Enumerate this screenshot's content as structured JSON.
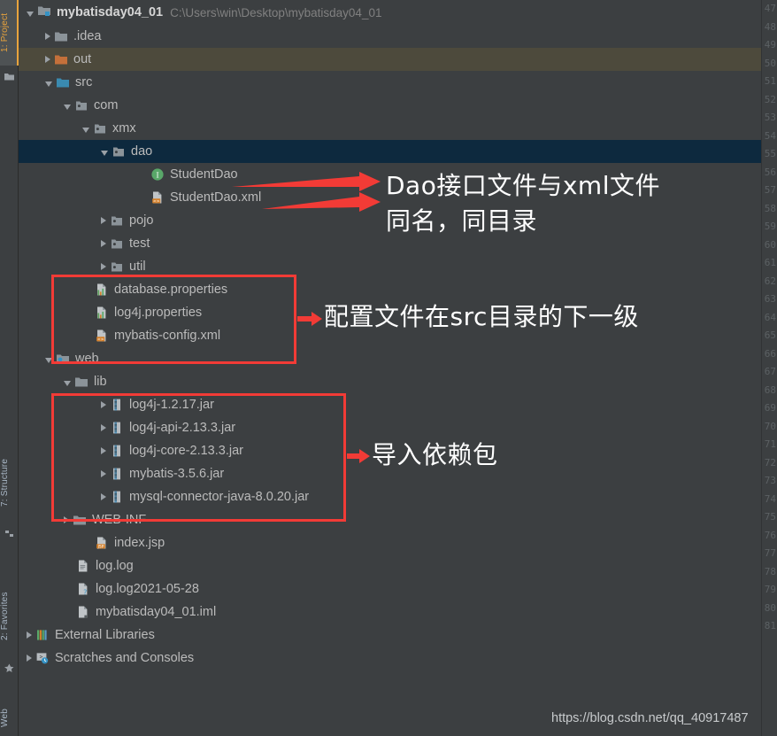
{
  "window": {
    "background_color": "#3c3f41",
    "accent_color": "#f23b36",
    "selected_row_color": "#0d293e",
    "modified_row_color": "#4d4a3c"
  },
  "left_tool_strip": {
    "tabs": [
      {
        "label": "1: Project",
        "active": true
      },
      {
        "label": "7: Structure",
        "active": false
      },
      {
        "label": "2: Favorites",
        "active": false
      },
      {
        "label": "Web",
        "active": false
      }
    ]
  },
  "project_tree": {
    "root": {
      "name": "mybatisday04_01",
      "path": "C:\\Users\\win\\Desktop\\mybatisday04_01",
      "icon": "project-module-icon",
      "state": "open"
    },
    "rows": [
      {
        "label": ".idea",
        "indent": 1,
        "state": "closed",
        "icon": "folder-icon",
        "highlight": "none"
      },
      {
        "label": "out",
        "indent": 1,
        "state": "closed",
        "icon": "folder-excluded-icon",
        "highlight": "olive"
      },
      {
        "label": "src",
        "indent": 1,
        "state": "open",
        "icon": "folder-source-icon",
        "highlight": "none"
      },
      {
        "label": "com",
        "indent": 2,
        "state": "open",
        "icon": "package-icon",
        "highlight": "none"
      },
      {
        "label": "xmx",
        "indent": 3,
        "state": "open",
        "icon": "package-icon",
        "highlight": "none"
      },
      {
        "label": "dao",
        "indent": 4,
        "state": "open",
        "icon": "package-icon",
        "highlight": "blue"
      },
      {
        "label": "StudentDao",
        "indent": 6,
        "state": "leaf",
        "icon": "java-interface-icon",
        "highlight": "none"
      },
      {
        "label": "StudentDao.xml",
        "indent": 6,
        "state": "leaf",
        "icon": "xml-file-icon",
        "highlight": "none"
      },
      {
        "label": "pojo",
        "indent": 4,
        "state": "closed",
        "icon": "package-icon",
        "highlight": "none"
      },
      {
        "label": "test",
        "indent": 4,
        "state": "closed",
        "icon": "package-icon",
        "highlight": "none"
      },
      {
        "label": "util",
        "indent": 4,
        "state": "closed",
        "icon": "package-icon",
        "highlight": "none"
      },
      {
        "label": "database.properties",
        "indent": 3,
        "state": "leaf",
        "icon": "properties-file-icon",
        "highlight": "none"
      },
      {
        "label": "log4j.properties",
        "indent": 3,
        "state": "leaf",
        "icon": "properties-file-icon",
        "highlight": "none"
      },
      {
        "label": "mybatis-config.xml",
        "indent": 3,
        "state": "leaf",
        "icon": "xml-file-icon",
        "highlight": "none"
      },
      {
        "label": "web",
        "indent": 1,
        "state": "open",
        "icon": "folder-web-icon",
        "highlight": "none"
      },
      {
        "label": "lib",
        "indent": 2,
        "state": "open",
        "icon": "folder-icon",
        "highlight": "none"
      },
      {
        "label": "log4j-1.2.17.jar",
        "indent": 4,
        "state": "closed",
        "icon": "jar-file-icon",
        "highlight": "none"
      },
      {
        "label": "log4j-api-2.13.3.jar",
        "indent": 4,
        "state": "closed",
        "icon": "jar-file-icon",
        "highlight": "none"
      },
      {
        "label": "log4j-core-2.13.3.jar",
        "indent": 4,
        "state": "closed",
        "icon": "jar-file-icon",
        "highlight": "none"
      },
      {
        "label": "mybatis-3.5.6.jar",
        "indent": 4,
        "state": "closed",
        "icon": "jar-file-icon",
        "highlight": "none"
      },
      {
        "label": "mysql-connector-java-8.0.20.jar",
        "indent": 4,
        "state": "closed",
        "icon": "jar-file-icon",
        "highlight": "none"
      },
      {
        "label": "WEB-INF",
        "indent": 2,
        "state": "closed",
        "icon": "folder-icon",
        "highlight": "none"
      },
      {
        "label": "index.jsp",
        "indent": 3,
        "state": "leaf",
        "icon": "jsp-file-icon",
        "highlight": "none"
      },
      {
        "label": "log.log",
        "indent": 2,
        "state": "leaf",
        "icon": "text-file-icon",
        "highlight": "none"
      },
      {
        "label": "log.log2021-05-28",
        "indent": 2,
        "state": "leaf",
        "icon": "unknown-file-icon",
        "highlight": "none"
      },
      {
        "label": "mybatisday04_01.iml",
        "indent": 2,
        "state": "leaf",
        "icon": "module-file-icon",
        "highlight": "none"
      },
      {
        "label": "External Libraries",
        "indent": 0,
        "state": "closed",
        "icon": "external-libraries-icon",
        "highlight": "none"
      },
      {
        "label": "Scratches and Consoles",
        "indent": 0,
        "state": "closed",
        "icon": "scratches-icon",
        "highlight": "none"
      }
    ]
  },
  "editor_gutter": {
    "first_line": 47,
    "last_line": 81,
    "lines": [
      47,
      48,
      49,
      50,
      51,
      52,
      53,
      54,
      55,
      56,
      57,
      58,
      59,
      60,
      61,
      62,
      63,
      64,
      65,
      66,
      67,
      68,
      69,
      70,
      71,
      72,
      73,
      74,
      75,
      76,
      77,
      78,
      79,
      80,
      81
    ]
  },
  "annotations": {
    "note_dao_line1": "Dao接口文件与xml文件",
    "note_dao_line2": "同名，同目录",
    "note_config": "配置文件在src目录的下一级",
    "note_jars": "导入依赖包"
  },
  "watermark": {
    "text": "https://blog.csdn.net/qq_40917487"
  }
}
